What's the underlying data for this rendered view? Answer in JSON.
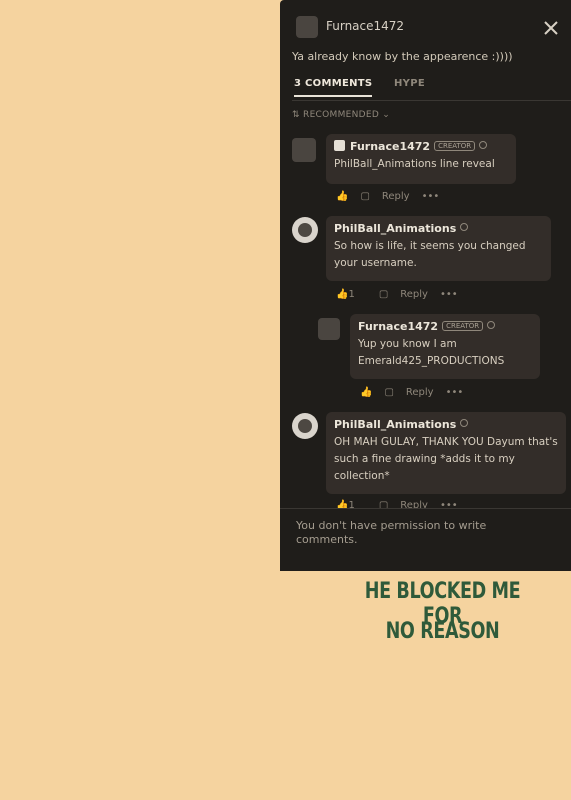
{
  "header": {
    "username": "Furnace1472",
    "description": "Ya already know by the appearence :))))"
  },
  "tabs": [
    {
      "label": "3 COMMENTS"
    },
    {
      "label": "HYPE"
    }
  ],
  "sort": {
    "label": "RECOMMENDED"
  },
  "comments": [
    {
      "author": "Furnace1472",
      "badge": "CREATOR",
      "text": "PhilBall_Animations line reveal",
      "actions": {
        "reply": "Reply",
        "more": "•••"
      }
    },
    {
      "author": "PhilBall_Animations",
      "text": "So how is life, it seems you changed your username.",
      "likes": "1",
      "actions": {
        "reply": "Reply",
        "more": "•••"
      }
    },
    {
      "author": "Furnace1472",
      "badge": "CREATOR",
      "text": "Yup you know I am Emerald425_PRODUCTIONS",
      "actions": {
        "reply": "Reply",
        "more": "•••"
      }
    },
    {
      "author": "PhilBall_Animations",
      "text": "OH MAH GULAY, THANK YOU Dayum that's such a fine drawing *adds it to my collection*",
      "likes": "1",
      "actions": {
        "reply": "Reply",
        "more": "•••"
      }
    }
  ],
  "footer": {
    "text": "You don't have permission to write comments."
  },
  "caption": {
    "line1": "HE BLOCKED ME FOR",
    "line2": "NO REASON"
  },
  "colors": {
    "background": "#f5d39f",
    "panel": "#1f1d1a",
    "bubble": "#332d29",
    "caption": "#2f5a3a"
  }
}
